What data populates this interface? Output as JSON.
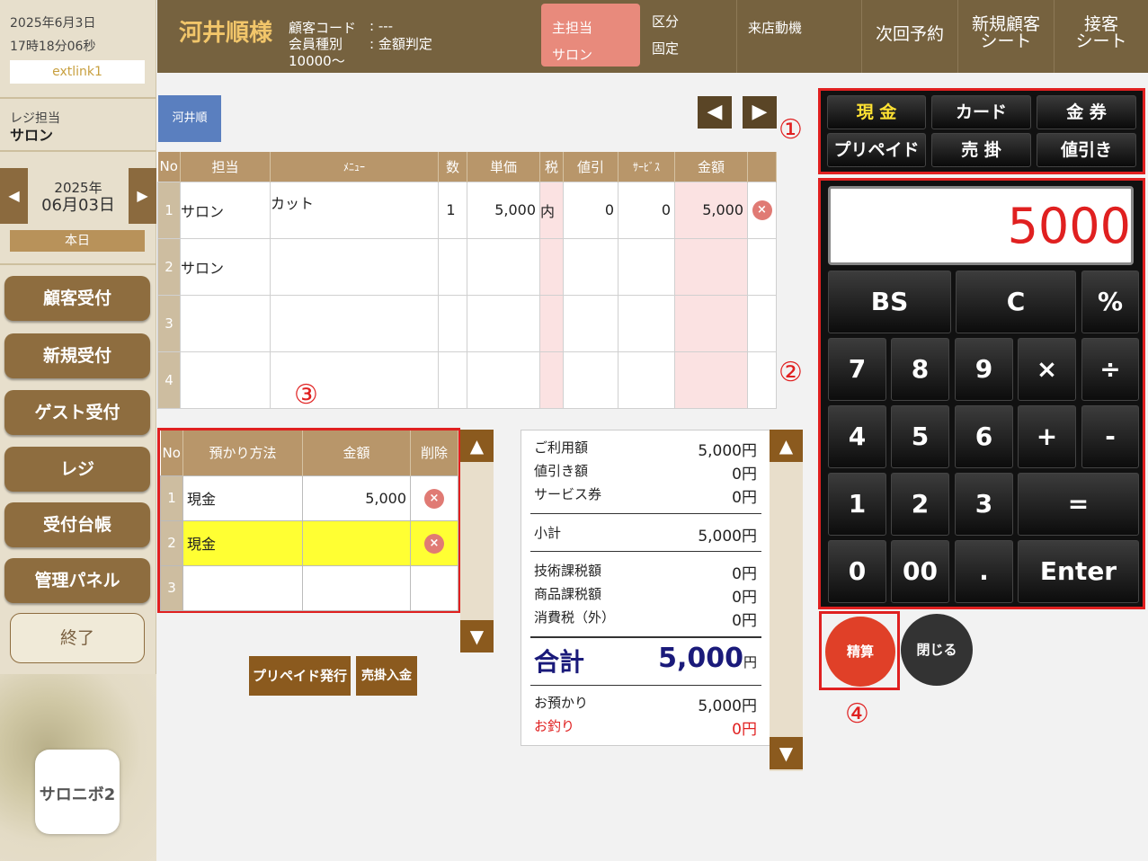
{
  "sidebar": {
    "date": "2025年6月3日",
    "time": "17時18分06秒",
    "extlink": "extlink1",
    "register_label": "レジ担当",
    "register_name": "サロン",
    "nav_date_year": "2025年",
    "nav_date_day": "06月03日",
    "prev_arrow": "◀",
    "next_arrow": "▶",
    "today": "本日",
    "buttons": [
      "顧客受付",
      "新規受付",
      "ゲスト受付",
      "レジ",
      "受付台帳",
      "管理パネル"
    ],
    "exit": "終了",
    "logo": "サロニボ2"
  },
  "header": {
    "customer_name": "河井順様",
    "customer_code_label": "顧客コード",
    "customer_code_value": ": ---",
    "member_type_label": "会員種別",
    "member_type_value": ": 金額判定",
    "member_amount": "10000〜",
    "tabs": {
      "main_staff_label": "主担当",
      "main_staff_value": "サロン",
      "category_label": "区分",
      "category_value": "固定",
      "visit_motive": "来店動機",
      "next_reservation": "次回予約",
      "new_customer_sheet_1": "新規顧客",
      "new_customer_sheet_2": "シート",
      "service_sheet_1": "接客",
      "service_sheet_2": "シート"
    }
  },
  "customer_button": "河井順",
  "pager": {
    "prev": "◀",
    "next": "▶"
  },
  "menu_table": {
    "headers": [
      "No",
      "担当",
      "ﾒﾆｭｰ",
      "数",
      "単価",
      "税",
      "値引",
      "ｻｰﾋﾞｽ",
      "金額",
      ""
    ],
    "rows": [
      {
        "no": "1",
        "staff": "サロン",
        "menu": "カット",
        "qty": "1",
        "price": "5,000",
        "tax": "内",
        "discount": "0",
        "service": "0",
        "amount": "5,000",
        "del": "×"
      },
      {
        "no": "2",
        "staff": "サロン",
        "menu": "",
        "qty": "",
        "price": "",
        "tax": "",
        "discount": "",
        "service": "",
        "amount": "",
        "del": ""
      },
      {
        "no": "3",
        "staff": "",
        "menu": "",
        "qty": "",
        "price": "",
        "tax": "",
        "discount": "",
        "service": "",
        "amount": "",
        "del": ""
      },
      {
        "no": "4",
        "staff": "",
        "menu": "",
        "qty": "",
        "price": "",
        "tax": "",
        "discount": "",
        "service": "",
        "amount": "",
        "del": ""
      }
    ]
  },
  "payment_table": {
    "headers": [
      "No",
      "預かり方法",
      "金額",
      "削除"
    ],
    "rows": [
      {
        "no": "1",
        "method": "現金",
        "amount": "5,000",
        "del": "×"
      },
      {
        "no": "2",
        "method": "現金",
        "amount": "",
        "del": "×"
      },
      {
        "no": "3",
        "method": "",
        "amount": "",
        "del": ""
      }
    ]
  },
  "scroll": {
    "up": "▲",
    "down": "▼"
  },
  "actions": {
    "prepaid_issue": "プリペイド発行",
    "credit_payment": "売掛入金"
  },
  "summary": {
    "usage_label": "ご利用額",
    "usage_value": "5,000円",
    "discount_label": "値引き額",
    "discount_value": "0円",
    "voucher_label": "サービス券",
    "voucher_value": "0円",
    "subtotal_label": "小計",
    "subtotal_value": "5,000円",
    "tech_tax_label": "技術課税額",
    "tech_tax_value": "0円",
    "product_tax_label": "商品課税額",
    "product_tax_value": "0円",
    "consumption_tax_label": "消費税（外）",
    "consumption_tax_value": "0円",
    "total_label": "合計",
    "total_value": "5,000",
    "total_unit": "円",
    "deposit_label": "お預かり",
    "deposit_value": "5,000円",
    "change_label": "お釣り",
    "change_value": "0円"
  },
  "pay_methods": [
    "現 金",
    "カード",
    "金 券",
    "プリペイド",
    "売 掛",
    "値引き"
  ],
  "calculator": {
    "display": "5000",
    "keys": [
      "BS",
      "C",
      "%",
      "7",
      "8",
      "9",
      "×",
      "÷",
      "4",
      "5",
      "6",
      "+",
      "-",
      "1",
      "2",
      "3",
      "=",
      "0",
      "00",
      ".",
      "Enter"
    ]
  },
  "annotations": [
    "①",
    "②",
    "③",
    "④"
  ],
  "buttons": {
    "checkout": "精算",
    "close": "閉じる"
  },
  "colors": {
    "accent_red": "#e02020",
    "header_brown": "#76623f",
    "button_brown": "#8e6d3f",
    "highlight_yellow": "#ffff33"
  }
}
